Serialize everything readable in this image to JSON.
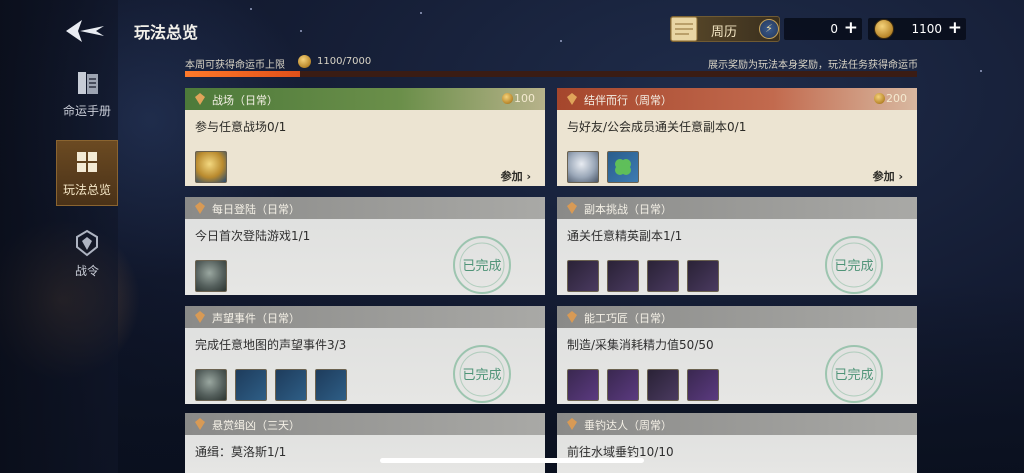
{
  "header": {
    "title": "玩法总览",
    "calendar_label": "周历",
    "energy_value": "0",
    "coin_value": "1100"
  },
  "sidebar": {
    "items": [
      {
        "label": "命运手册",
        "icon": "book-icon"
      },
      {
        "label": "玩法总览",
        "icon": "grid-icon"
      },
      {
        "label": "战令",
        "icon": "pass-emblem-icon"
      }
    ]
  },
  "weekly": {
    "label": "本周可获得命运币上限",
    "count": "1100/7000",
    "progress": 0.157,
    "note": "展示奖励为玩法本身奖励，玩法任务获得命运币"
  },
  "cards": [
    {
      "title": "战场（日常）",
      "reward": "100",
      "desc": "参与任意战场0/1",
      "status": "参加",
      "theme": "green"
    },
    {
      "title": "结伴而行（周常）",
      "reward": "200",
      "desc": "与好友/公会成员通关任意副本0/1",
      "status": "参加",
      "theme": "red"
    },
    {
      "title": "每日登陆（日常）",
      "desc": "今日首次登陆游戏1/1",
      "status": "已完成",
      "theme": "gray"
    },
    {
      "title": "副本挑战（日常）",
      "desc": "通关任意精英副本1/1",
      "status": "已完成",
      "theme": "gray"
    },
    {
      "title": "声望事件（日常）",
      "desc": "完成任意地图的声望事件3/3",
      "status": "已完成",
      "theme": "gray"
    },
    {
      "title": "能工巧匠（日常）",
      "desc": "制造/采集消耗精力值50/50",
      "status": "已完成",
      "theme": "gray"
    },
    {
      "title": "悬赏缉凶（三天）",
      "desc": "通缉：莫洛斯1/1",
      "theme": "gray"
    },
    {
      "title": "垂钓达人（周常）",
      "desc": "前往水域垂钓10/10",
      "theme": "gray"
    }
  ],
  "colors": {
    "progress": "#ff7a2a",
    "accent_gold": "#c4a25a",
    "card_green": "#4d7a3a",
    "card_red": "#a5462c"
  }
}
